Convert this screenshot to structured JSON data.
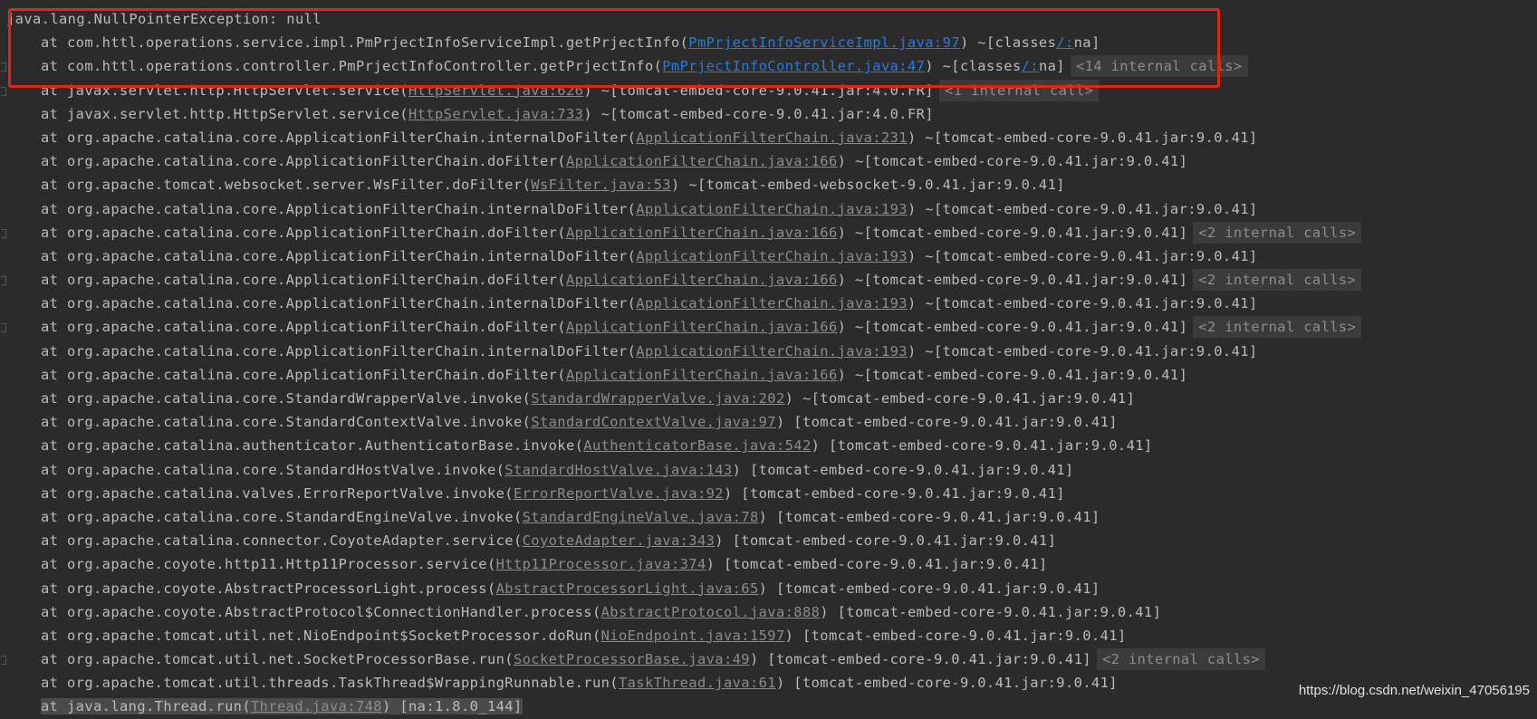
{
  "exception": "java.lang.NullPointerException: null",
  "colors": {
    "background": "#2b2b2b",
    "text": "#bbbbbb",
    "link": "#8c8c8c",
    "user_link": "#287bde",
    "highlight_box": "#e8201c",
    "badge_bg": "#3b3b3b"
  },
  "frames": [
    {
      "method": "at com.httl.operations.service.impl.PmPrjectInfoServiceImpl.getPrjectInfo(",
      "link": "PmPrjectInfoServiceImpl.java:97",
      "mid": ") ~[classes",
      "slash": "/:",
      "end": "na]",
      "badge": "",
      "user": true,
      "fold": false
    },
    {
      "method": "at com.httl.operations.controller.PmPrjectInfoController.getPrjectInfo(",
      "link": "PmPrjectInfoController.java:47",
      "mid": ") ~[classes",
      "slash": "/:",
      "end": "na]",
      "badge": "<14 internal calls>",
      "user": true,
      "fold": true
    },
    {
      "method": "at javax.servlet.http.HttpServlet.service(",
      "link": "HttpServlet.java:626",
      "mid": ") ~[tomcat-embed-core-9.0.41.jar:4.0.FR]",
      "badge": "<1 internal call>",
      "fold": true
    },
    {
      "method": "at javax.servlet.http.HttpServlet.service(",
      "link": "HttpServlet.java:733",
      "mid": ") ~[tomcat-embed-core-9.0.41.jar:4.0.FR]",
      "badge": ""
    },
    {
      "method": "at org.apache.catalina.core.ApplicationFilterChain.internalDoFilter(",
      "link": "ApplicationFilterChain.java:231",
      "mid": ") ~[tomcat-embed-core-9.0.41.jar:9.0.41]",
      "badge": ""
    },
    {
      "method": "at org.apache.catalina.core.ApplicationFilterChain.doFilter(",
      "link": "ApplicationFilterChain.java:166",
      "mid": ") ~[tomcat-embed-core-9.0.41.jar:9.0.41]",
      "badge": ""
    },
    {
      "method": "at org.apache.tomcat.websocket.server.WsFilter.doFilter(",
      "link": "WsFilter.java:53",
      "mid": ") ~[tomcat-embed-websocket-9.0.41.jar:9.0.41]",
      "badge": ""
    },
    {
      "method": "at org.apache.catalina.core.ApplicationFilterChain.internalDoFilter(",
      "link": "ApplicationFilterChain.java:193",
      "mid": ") ~[tomcat-embed-core-9.0.41.jar:9.0.41]",
      "badge": ""
    },
    {
      "method": "at org.apache.catalina.core.ApplicationFilterChain.doFilter(",
      "link": "ApplicationFilterChain.java:166",
      "mid": ") ~[tomcat-embed-core-9.0.41.jar:9.0.41]",
      "badge": "<2 internal calls>",
      "fold": true
    },
    {
      "method": "at org.apache.catalina.core.ApplicationFilterChain.internalDoFilter(",
      "link": "ApplicationFilterChain.java:193",
      "mid": ") ~[tomcat-embed-core-9.0.41.jar:9.0.41]",
      "badge": ""
    },
    {
      "method": "at org.apache.catalina.core.ApplicationFilterChain.doFilter(",
      "link": "ApplicationFilterChain.java:166",
      "mid": ") ~[tomcat-embed-core-9.0.41.jar:9.0.41]",
      "badge": "<2 internal calls>",
      "fold": true
    },
    {
      "method": "at org.apache.catalina.core.ApplicationFilterChain.internalDoFilter(",
      "link": "ApplicationFilterChain.java:193",
      "mid": ") ~[tomcat-embed-core-9.0.41.jar:9.0.41]",
      "badge": ""
    },
    {
      "method": "at org.apache.catalina.core.ApplicationFilterChain.doFilter(",
      "link": "ApplicationFilterChain.java:166",
      "mid": ") ~[tomcat-embed-core-9.0.41.jar:9.0.41]",
      "badge": "<2 internal calls>",
      "fold": true
    },
    {
      "method": "at org.apache.catalina.core.ApplicationFilterChain.internalDoFilter(",
      "link": "ApplicationFilterChain.java:193",
      "mid": ") ~[tomcat-embed-core-9.0.41.jar:9.0.41]",
      "badge": ""
    },
    {
      "method": "at org.apache.catalina.core.ApplicationFilterChain.doFilter(",
      "link": "ApplicationFilterChain.java:166",
      "mid": ") ~[tomcat-embed-core-9.0.41.jar:9.0.41]",
      "badge": ""
    },
    {
      "method": "at org.apache.catalina.core.StandardWrapperValve.invoke(",
      "link": "StandardWrapperValve.java:202",
      "mid": ") ~[tomcat-embed-core-9.0.41.jar:9.0.41]",
      "badge": ""
    },
    {
      "method": "at org.apache.catalina.core.StandardContextValve.invoke(",
      "link": "StandardContextValve.java:97",
      "mid": ") [tomcat-embed-core-9.0.41.jar:9.0.41]",
      "badge": ""
    },
    {
      "method": "at org.apache.catalina.authenticator.AuthenticatorBase.invoke(",
      "link": "AuthenticatorBase.java:542",
      "mid": ") [tomcat-embed-core-9.0.41.jar:9.0.41]",
      "badge": ""
    },
    {
      "method": "at org.apache.catalina.core.StandardHostValve.invoke(",
      "link": "StandardHostValve.java:143",
      "mid": ") [tomcat-embed-core-9.0.41.jar:9.0.41]",
      "badge": ""
    },
    {
      "method": "at org.apache.catalina.valves.ErrorReportValve.invoke(",
      "link": "ErrorReportValve.java:92",
      "mid": ") [tomcat-embed-core-9.0.41.jar:9.0.41]",
      "badge": ""
    },
    {
      "method": "at org.apache.catalina.core.StandardEngineValve.invoke(",
      "link": "StandardEngineValve.java:78",
      "mid": ") [tomcat-embed-core-9.0.41.jar:9.0.41]",
      "badge": ""
    },
    {
      "method": "at org.apache.catalina.connector.CoyoteAdapter.service(",
      "link": "CoyoteAdapter.java:343",
      "mid": ") [tomcat-embed-core-9.0.41.jar:9.0.41]",
      "badge": ""
    },
    {
      "method": "at org.apache.coyote.http11.Http11Processor.service(",
      "link": "Http11Processor.java:374",
      "mid": ") [tomcat-embed-core-9.0.41.jar:9.0.41]",
      "badge": ""
    },
    {
      "method": "at org.apache.coyote.AbstractProcessorLight.process(",
      "link": "AbstractProcessorLight.java:65",
      "mid": ") [tomcat-embed-core-9.0.41.jar:9.0.41]",
      "badge": ""
    },
    {
      "method": "at org.apache.coyote.AbstractProtocol$ConnectionHandler.process(",
      "link": "AbstractProtocol.java:888",
      "mid": ") [tomcat-embed-core-9.0.41.jar:9.0.41]",
      "badge": ""
    },
    {
      "method": "at org.apache.tomcat.util.net.NioEndpoint$SocketProcessor.doRun(",
      "link": "NioEndpoint.java:1597",
      "mid": ") [tomcat-embed-core-9.0.41.jar:9.0.41]",
      "badge": ""
    },
    {
      "method": "at org.apache.tomcat.util.net.SocketProcessorBase.run(",
      "link": "SocketProcessorBase.java:49",
      "mid": ") [tomcat-embed-core-9.0.41.jar:9.0.41]",
      "badge": "<2 internal calls>",
      "fold": true
    },
    {
      "method": "at org.apache.tomcat.util.threads.TaskThread$WrappingRunnable.run(",
      "link": "TaskThread.java:61",
      "mid": ") [tomcat-embed-core-9.0.41.jar:9.0.41]",
      "badge": ""
    },
    {
      "method": "at java.lang.Thread.run(",
      "link": "Thread.java:748",
      "mid": ") [na:1.8.0_144]",
      "badge": "",
      "selected": true
    }
  ],
  "watermark": "https://blog.csdn.net/weixin_47056195"
}
